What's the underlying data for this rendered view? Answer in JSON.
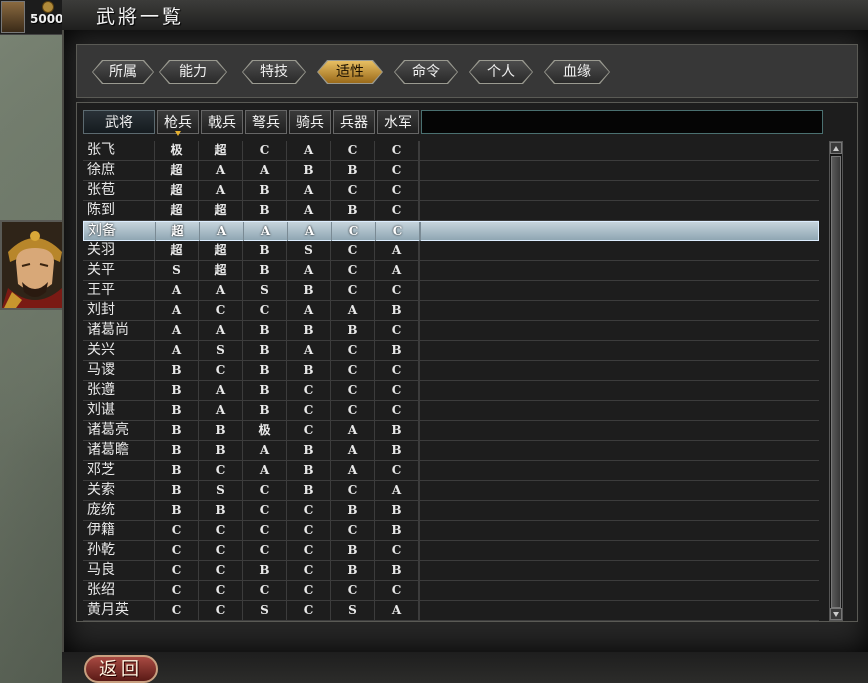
{
  "topbar": {
    "gold": "5000"
  },
  "window": {
    "title": "武將一覧"
  },
  "tabs": [
    {
      "label": "所属",
      "active": false
    },
    {
      "label": "能力",
      "active": false
    },
    {
      "label": "特技",
      "active": false
    },
    {
      "label": "适性",
      "active": true
    },
    {
      "label": "命令",
      "active": false
    },
    {
      "label": "个人",
      "active": false
    },
    {
      "label": "血缘",
      "active": false
    }
  ],
  "columns": [
    "武将",
    "枪兵",
    "戟兵",
    "弩兵",
    "骑兵",
    "兵器",
    "水军"
  ],
  "sort_column": "枪兵",
  "rows": [
    {
      "name": "张飞",
      "grades": [
        "极",
        "超",
        "C",
        "A",
        "C",
        "C"
      ]
    },
    {
      "name": "徐庶",
      "grades": [
        "超",
        "A",
        "A",
        "B",
        "B",
        "C"
      ]
    },
    {
      "name": "张苞",
      "grades": [
        "超",
        "A",
        "B",
        "A",
        "C",
        "C"
      ]
    },
    {
      "name": "陈到",
      "grades": [
        "超",
        "超",
        "B",
        "A",
        "B",
        "C"
      ]
    },
    {
      "name": "刘备",
      "grades": [
        "超",
        "A",
        "A",
        "A",
        "C",
        "C"
      ],
      "selected": true
    },
    {
      "name": "关羽",
      "grades": [
        "超",
        "超",
        "B",
        "S",
        "C",
        "A"
      ]
    },
    {
      "name": "关平",
      "grades": [
        "S",
        "超",
        "B",
        "A",
        "C",
        "A"
      ]
    },
    {
      "name": "王平",
      "grades": [
        "A",
        "A",
        "S",
        "B",
        "C",
        "C"
      ]
    },
    {
      "name": "刘封",
      "grades": [
        "A",
        "C",
        "C",
        "A",
        "A",
        "B"
      ]
    },
    {
      "name": "诸葛尚",
      "grades": [
        "A",
        "A",
        "B",
        "B",
        "B",
        "C"
      ]
    },
    {
      "name": "关兴",
      "grades": [
        "A",
        "S",
        "B",
        "A",
        "C",
        "B"
      ]
    },
    {
      "name": "马谡",
      "grades": [
        "B",
        "C",
        "B",
        "B",
        "C",
        "C"
      ]
    },
    {
      "name": "张遵",
      "grades": [
        "B",
        "A",
        "B",
        "C",
        "C",
        "C"
      ]
    },
    {
      "name": "刘谌",
      "grades": [
        "B",
        "A",
        "B",
        "C",
        "C",
        "C"
      ]
    },
    {
      "name": "诸葛亮",
      "grades": [
        "B",
        "B",
        "极",
        "C",
        "A",
        "B"
      ]
    },
    {
      "name": "诸葛瞻",
      "grades": [
        "B",
        "B",
        "A",
        "B",
        "A",
        "B"
      ]
    },
    {
      "name": "邓芝",
      "grades": [
        "B",
        "C",
        "A",
        "B",
        "A",
        "C"
      ]
    },
    {
      "name": "关索",
      "grades": [
        "B",
        "S",
        "C",
        "B",
        "C",
        "A"
      ]
    },
    {
      "name": "庞统",
      "grades": [
        "B",
        "B",
        "C",
        "C",
        "B",
        "B"
      ]
    },
    {
      "name": "伊籍",
      "grades": [
        "C",
        "C",
        "C",
        "C",
        "C",
        "B"
      ]
    },
    {
      "name": "孙乾",
      "grades": [
        "C",
        "C",
        "C",
        "C",
        "B",
        "C"
      ]
    },
    {
      "name": "马良",
      "grades": [
        "C",
        "C",
        "B",
        "C",
        "B",
        "B"
      ]
    },
    {
      "name": "张绍",
      "grades": [
        "C",
        "C",
        "C",
        "C",
        "C",
        "C"
      ]
    },
    {
      "name": "黄月英",
      "grades": [
        "C",
        "C",
        "S",
        "C",
        "S",
        "A"
      ]
    }
  ],
  "footer": {
    "return_label": "返回"
  },
  "colors": {
    "active_tab": "#c8962e",
    "selected_row": "#a9bcc7",
    "return_button": "#8a3530"
  }
}
